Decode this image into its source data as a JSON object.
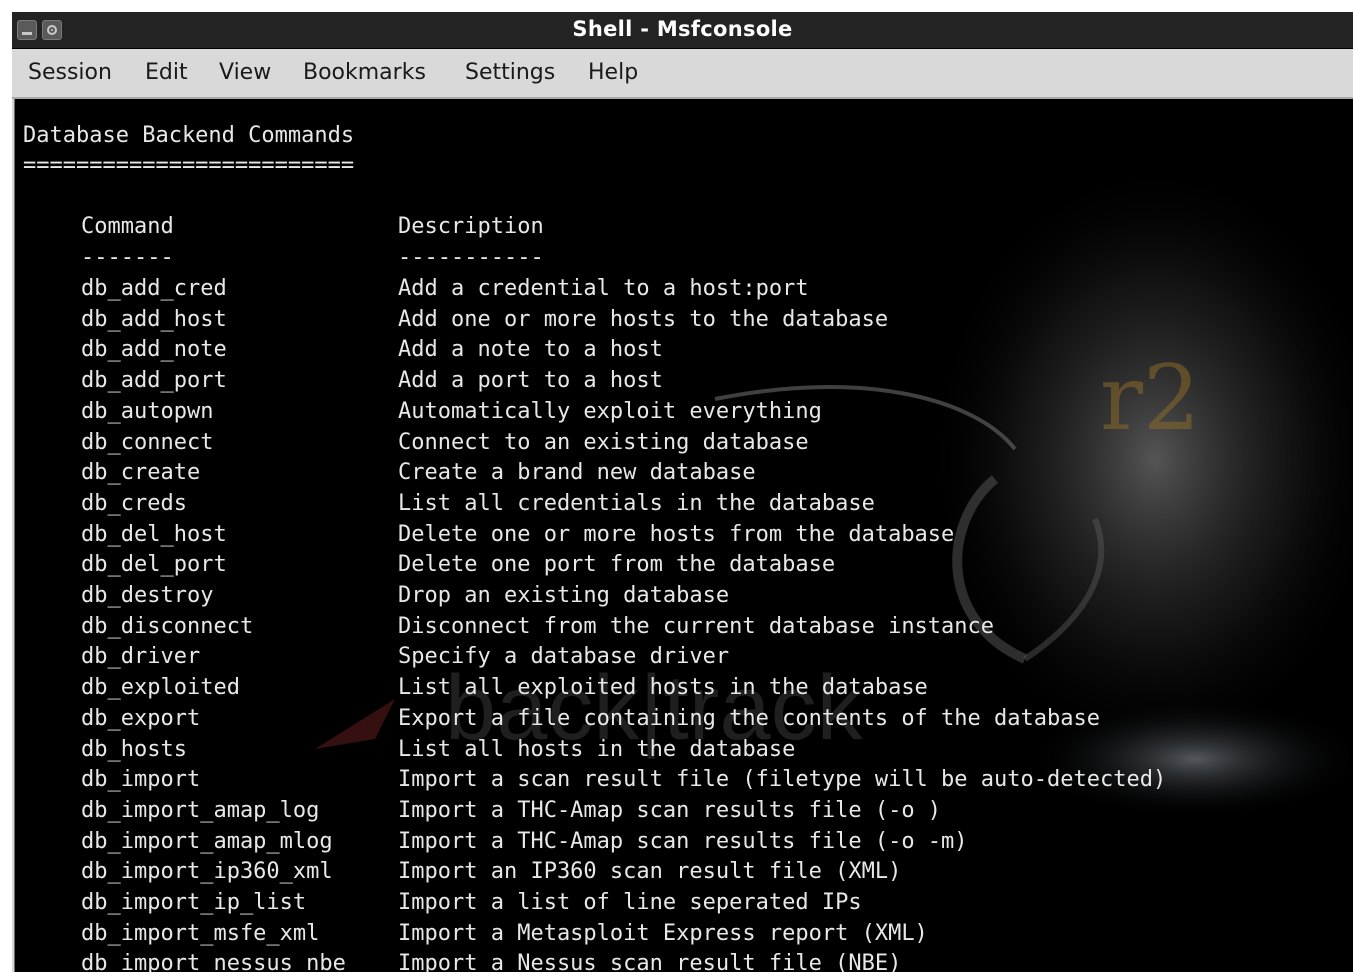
{
  "window": {
    "title": "Shell - Msfconsole"
  },
  "menubar": [
    "Session",
    "Edit",
    "View",
    "Bookmarks",
    "Settings",
    "Help"
  ],
  "terminal": {
    "heading": "Database Backend Commands",
    "heading_rule": "=========================",
    "columns": {
      "command": "Command",
      "description": "Description"
    },
    "column_rules": {
      "command": "-------",
      "description": "-----------"
    },
    "rows": [
      {
        "command": "db_add_cred",
        "description": "Add a credential to a host:port"
      },
      {
        "command": "db_add_host",
        "description": "Add one or more hosts to the database"
      },
      {
        "command": "db_add_note",
        "description": "Add a note to a host"
      },
      {
        "command": "db_add_port",
        "description": "Add a port to a host"
      },
      {
        "command": "db_autopwn",
        "description": "Automatically exploit everything"
      },
      {
        "command": "db_connect",
        "description": "Connect to an existing database"
      },
      {
        "command": "db_create",
        "description": "Create a brand new database"
      },
      {
        "command": "db_creds",
        "description": "List all credentials in the database"
      },
      {
        "command": "db_del_host",
        "description": "Delete one or more hosts from the database"
      },
      {
        "command": "db_del_port",
        "description": "Delete one port from the database"
      },
      {
        "command": "db_destroy",
        "description": "Drop an existing database"
      },
      {
        "command": "db_disconnect",
        "description": "Disconnect from the current database instance"
      },
      {
        "command": "db_driver",
        "description": "Specify a database driver"
      },
      {
        "command": "db_exploited",
        "description": "List all exploited hosts in the database"
      },
      {
        "command": "db_export",
        "description": "Export a file containing the contents of the database"
      },
      {
        "command": "db_hosts",
        "description": "List all hosts in the database"
      },
      {
        "command": "db_import",
        "description": "Import a scan result file (filetype will be auto-detected)"
      },
      {
        "command": "db_import_amap_log",
        "description": "Import a THC-Amap scan results file (-o )"
      },
      {
        "command": "db_import_amap_mlog",
        "description": "Import a THC-Amap scan results file (-o -m)"
      },
      {
        "command": "db_import_ip360_xml",
        "description": "Import an IP360 scan result file (XML)"
      },
      {
        "command": "db_import_ip_list",
        "description": "Import a list of line seperated IPs"
      },
      {
        "command": "db_import_msfe_xml",
        "description": "Import a Metasploit Express report (XML)"
      },
      {
        "command": "db_import_nessus_nbe",
        "description": "Import a Nessus scan result file (NBE)"
      }
    ],
    "wallpaper": {
      "brand_mark": "back|track",
      "version_mark": "r2"
    }
  },
  "colors": {
    "terminal_bg": "#000000",
    "terminal_fg": "#e8e8e8",
    "titlebar_bg": "#232323",
    "menubar_bg": "#d9d9d9"
  }
}
